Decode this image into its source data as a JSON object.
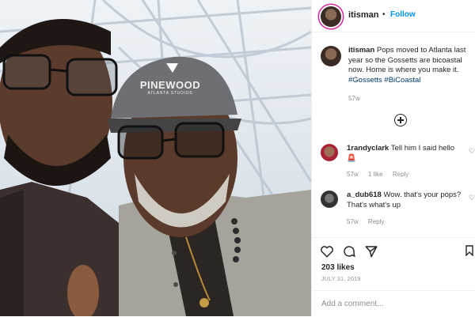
{
  "post": {
    "username": "itisman",
    "follow_label": "Follow",
    "separator": "•",
    "caption_text": "Pops moved to Atlanta last year so the Gossetts are bicoastal now. Home is where you make it.",
    "hashtags": [
      "#Gossetts",
      "#BiCoastal"
    ],
    "caption_time": "57w",
    "likes": "203 likes",
    "date": "JULY 31, 2019",
    "add_comment_placeholder": "Add a comment..."
  },
  "photo": {
    "cap_line1": "PINEWOOD",
    "cap_line2": "ATLANTA STUDIOS"
  },
  "comments": [
    {
      "username": "1randyclark",
      "text": "Tell him I said hello",
      "emoji": "🚨",
      "time": "57w",
      "likes": "1 like",
      "reply": "Reply"
    },
    {
      "username": "a_dub618",
      "text": "Wow. that's your pops? That's what's up",
      "time": "57w",
      "reply": "Reply"
    }
  ],
  "icons": [
    "heart-icon",
    "comment-icon",
    "share-icon",
    "bookmark-icon",
    "plus-circle-icon"
  ],
  "colors": {
    "link": "#0095f6",
    "hashtag": "#00376b",
    "muted": "#8e8e8e"
  }
}
